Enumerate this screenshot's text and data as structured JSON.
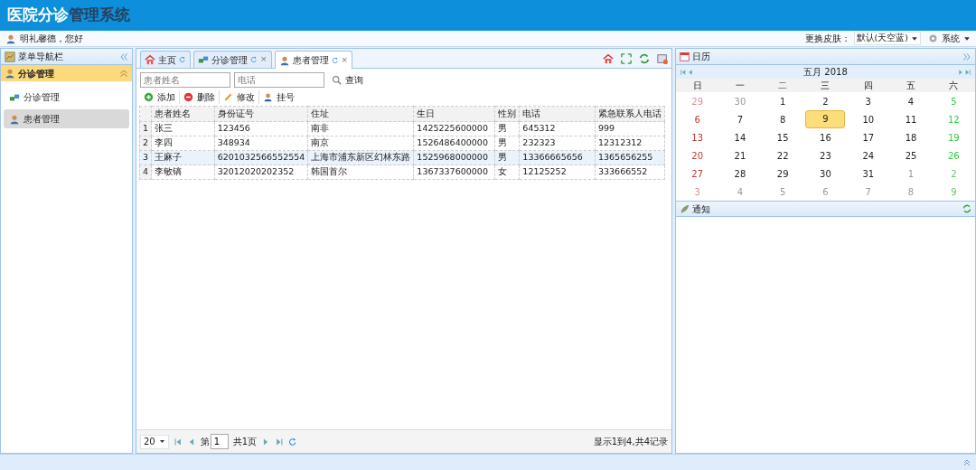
{
  "header": {
    "title": [
      "医院分诊",
      "管理系统"
    ]
  },
  "user_bar": {
    "greeting": "明礼馨德，您好",
    "skin_label": "更换皮肤：",
    "skin_value": "默认(天空蓝)",
    "system_menu": "系统"
  },
  "sidebar": {
    "title": "菜单导航栏",
    "groups": [
      {
        "label": "分诊管理",
        "expanded": true,
        "items": [
          {
            "label": "分诊管理",
            "kind": "link",
            "selected": false
          },
          {
            "label": "患者管理",
            "kind": "user",
            "selected": true
          }
        ]
      }
    ]
  },
  "tabs": [
    {
      "label": "主页",
      "kind": "home",
      "closable": false,
      "selected": false
    },
    {
      "label": "分诊管理",
      "kind": "link",
      "closable": true,
      "selected": false
    },
    {
      "label": "患者管理",
      "kind": "user",
      "closable": true,
      "selected": true
    }
  ],
  "tab_close": "×",
  "search": {
    "name_placeholder": "患者姓名",
    "phone_placeholder": "电话",
    "button": "查询"
  },
  "toolbar": [
    {
      "label": "添加",
      "kind": "add"
    },
    {
      "label": "删除",
      "kind": "delete"
    },
    {
      "label": "修改",
      "kind": "edit"
    },
    {
      "label": "挂号",
      "kind": "register"
    }
  ],
  "table": {
    "columns": [
      "患者姓名",
      "身份证号",
      "住址",
      "生日",
      "性别",
      "电话",
      "紧急联系人电话"
    ],
    "rows": [
      {
        "index": "1",
        "cells": [
          "张三",
          "123456",
          "南非",
          "1425225600000",
          "男",
          "645312",
          "999"
        ],
        "selected": false
      },
      {
        "index": "2",
        "cells": [
          "李四",
          "348934",
          "南京",
          "1526486400000",
          "男",
          "232323",
          "12312312"
        ],
        "selected": false
      },
      {
        "index": "3",
        "cells": [
          "王麻子",
          "6201032566552554",
          "上海市浦东新区幻林东路",
          "1525968000000",
          "男",
          "13366665656",
          "1365656255"
        ],
        "selected": true
      },
      {
        "index": "4",
        "cells": [
          "李敏镐",
          "32012020202352",
          "韩国首尔",
          "1367337600000",
          "女",
          "12125252",
          "333666552"
        ],
        "selected": false
      }
    ]
  },
  "pager": {
    "page_size": "20",
    "page_prefix": "第",
    "page": "1",
    "page_total": "共1页",
    "summary": "显示1到4,共4记录"
  },
  "calendar": {
    "title": "日历",
    "month": "五月 2018",
    "weekdays": [
      "日",
      "一",
      "二",
      "三",
      "四",
      "五",
      "六"
    ],
    "weeks": [
      [
        {
          "day": "29",
          "kind": "other"
        },
        {
          "day": "30",
          "kind": "other"
        },
        {
          "day": "1",
          "kind": "current"
        },
        {
          "day": "2",
          "kind": "current"
        },
        {
          "day": "3",
          "kind": "current"
        },
        {
          "day": "4",
          "kind": "current"
        },
        {
          "day": "5",
          "kind": "current"
        }
      ],
      [
        {
          "day": "6",
          "kind": "current"
        },
        {
          "day": "7",
          "kind": "current"
        },
        {
          "day": "8",
          "kind": "current"
        },
        {
          "day": "9",
          "kind": "current",
          "selected": true
        },
        {
          "day": "10",
          "kind": "current"
        },
        {
          "day": "11",
          "kind": "current"
        },
        {
          "day": "12",
          "kind": "current"
        }
      ],
      [
        {
          "day": "13",
          "kind": "current"
        },
        {
          "day": "14",
          "kind": "current"
        },
        {
          "day": "15",
          "kind": "current"
        },
        {
          "day": "16",
          "kind": "current"
        },
        {
          "day": "17",
          "kind": "current"
        },
        {
          "day": "18",
          "kind": "current"
        },
        {
          "day": "19",
          "kind": "current"
        }
      ],
      [
        {
          "day": "20",
          "kind": "current"
        },
        {
          "day": "21",
          "kind": "current"
        },
        {
          "day": "22",
          "kind": "current"
        },
        {
          "day": "23",
          "kind": "current"
        },
        {
          "day": "24",
          "kind": "current"
        },
        {
          "day": "25",
          "kind": "current"
        },
        {
          "day": "26",
          "kind": "current"
        }
      ],
      [
        {
          "day": "27",
          "kind": "current"
        },
        {
          "day": "28",
          "kind": "current"
        },
        {
          "day": "29",
          "kind": "current"
        },
        {
          "day": "30",
          "kind": "current"
        },
        {
          "day": "31",
          "kind": "current"
        },
        {
          "day": "1",
          "kind": "other"
        },
        {
          "day": "2",
          "kind": "other"
        }
      ],
      [
        {
          "day": "3",
          "kind": "other"
        },
        {
          "day": "4",
          "kind": "other"
        },
        {
          "day": "5",
          "kind": "other"
        },
        {
          "day": "6",
          "kind": "other"
        },
        {
          "day": "7",
          "kind": "other"
        },
        {
          "day": "8",
          "kind": "other"
        },
        {
          "day": "9",
          "kind": "other"
        }
      ]
    ]
  },
  "notice": {
    "title": "通知"
  }
}
